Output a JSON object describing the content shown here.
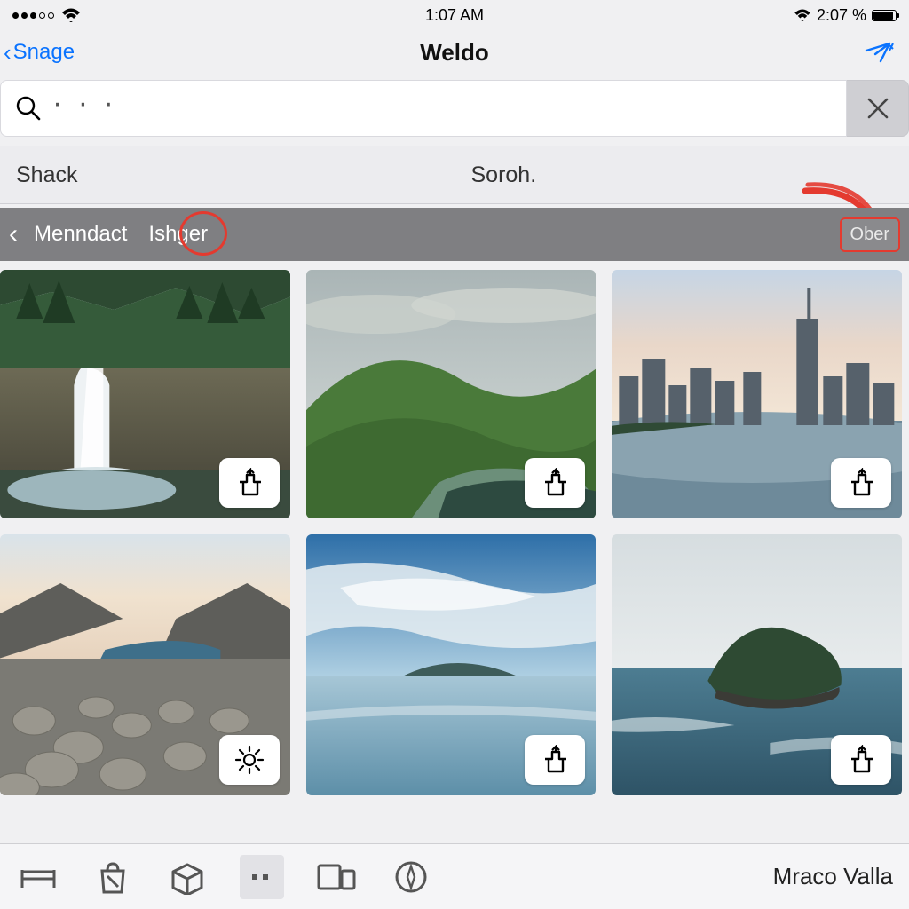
{
  "statusbar": {
    "time": "1:07 AM",
    "battery_text": "2:07 %"
  },
  "nav": {
    "back_label": "Snage",
    "title": "Weldo"
  },
  "search": {
    "placeholder": "· · ·"
  },
  "segment": {
    "left": "Shack",
    "right": "Soroh."
  },
  "breadcrumb": {
    "item1": "Menndact",
    "item2": "Ishger",
    "right_button": "Ober"
  },
  "tiles": [
    {
      "name": "tile-waterfall",
      "badge": "share-icon"
    },
    {
      "name": "tile-hills",
      "badge": "share-icon"
    },
    {
      "name": "tile-skyline",
      "badge": "share-icon"
    },
    {
      "name": "tile-rocky-lake",
      "badge": "sun-icon"
    },
    {
      "name": "tile-calm-sea",
      "badge": "share-icon"
    },
    {
      "name": "tile-island",
      "badge": "share-icon"
    }
  ],
  "toolbar": {
    "user_label": "Mraco Valla"
  }
}
